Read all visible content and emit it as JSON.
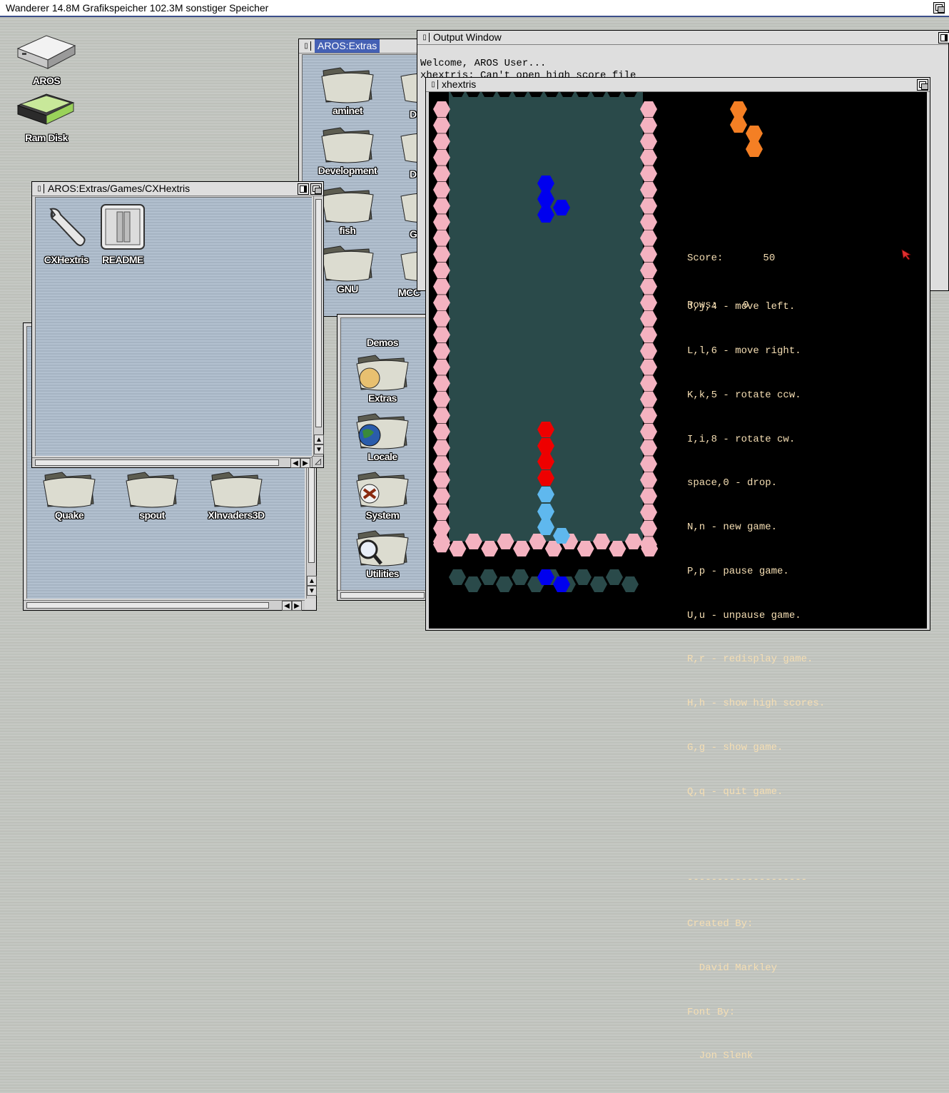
{
  "screen": {
    "title": "Wanderer 14.8M Grafikspeicher 102.3M sonstiger Speicher"
  },
  "desktop_icons": [
    {
      "label": "AROS",
      "icon": "harddisk-icon"
    },
    {
      "label": "Ram Disk",
      "icon": "ramdisk-icon"
    }
  ],
  "extras_window": {
    "title": "AROS:Extras",
    "folders": [
      "aminet",
      "Development",
      "fish",
      "GNU",
      "Demos",
      "Extras",
      "Locale",
      "System",
      "Utilities"
    ],
    "partial_labels": [
      "D",
      "D",
      "G",
      "MCC"
    ]
  },
  "games_window": {
    "folders": [
      "Quake",
      "spout",
      "XInvaders3D"
    ]
  },
  "cxhextris_window": {
    "title": "AROS:Extras/Games/CXHextris",
    "items": [
      {
        "label": "CXHextris",
        "icon": "wrench-icon"
      },
      {
        "label": "README",
        "icon": "document-icon"
      }
    ]
  },
  "output_window": {
    "title": "Output Window",
    "lines": [
      "Welcome, AROS User...",
      "xhextris: Can't open high score file"
    ]
  },
  "xhextris_window": {
    "title": "xhextris",
    "score_label": "Score:",
    "score_value": "50",
    "rows_label": "Rows:",
    "rows_value": "0",
    "help": [
      "J,j,4 - move left.",
      "L,l,6 - move right.",
      "K,k,5 - rotate ccw.",
      "I,i,8 - rotate cw.",
      "space,0 - drop.",
      "N,n - new game.",
      "P,p - pause game.",
      "U,u - unpause game.",
      "R,r - redisplay game.",
      "H,h - show high scores.",
      "G,g - show game.",
      "Q,q - quit game."
    ],
    "separator": "--------------------",
    "credits": [
      "Created By:",
      "  David Markley",
      "Font By:",
      "  Jon Slenk"
    ],
    "colors": {
      "wall": "#f4b2c0",
      "well": "#2a4a4a",
      "falling": "#0000ee",
      "next": "#f47f24",
      "red": "#ee0000",
      "cyan": "#5fb8ee"
    }
  }
}
